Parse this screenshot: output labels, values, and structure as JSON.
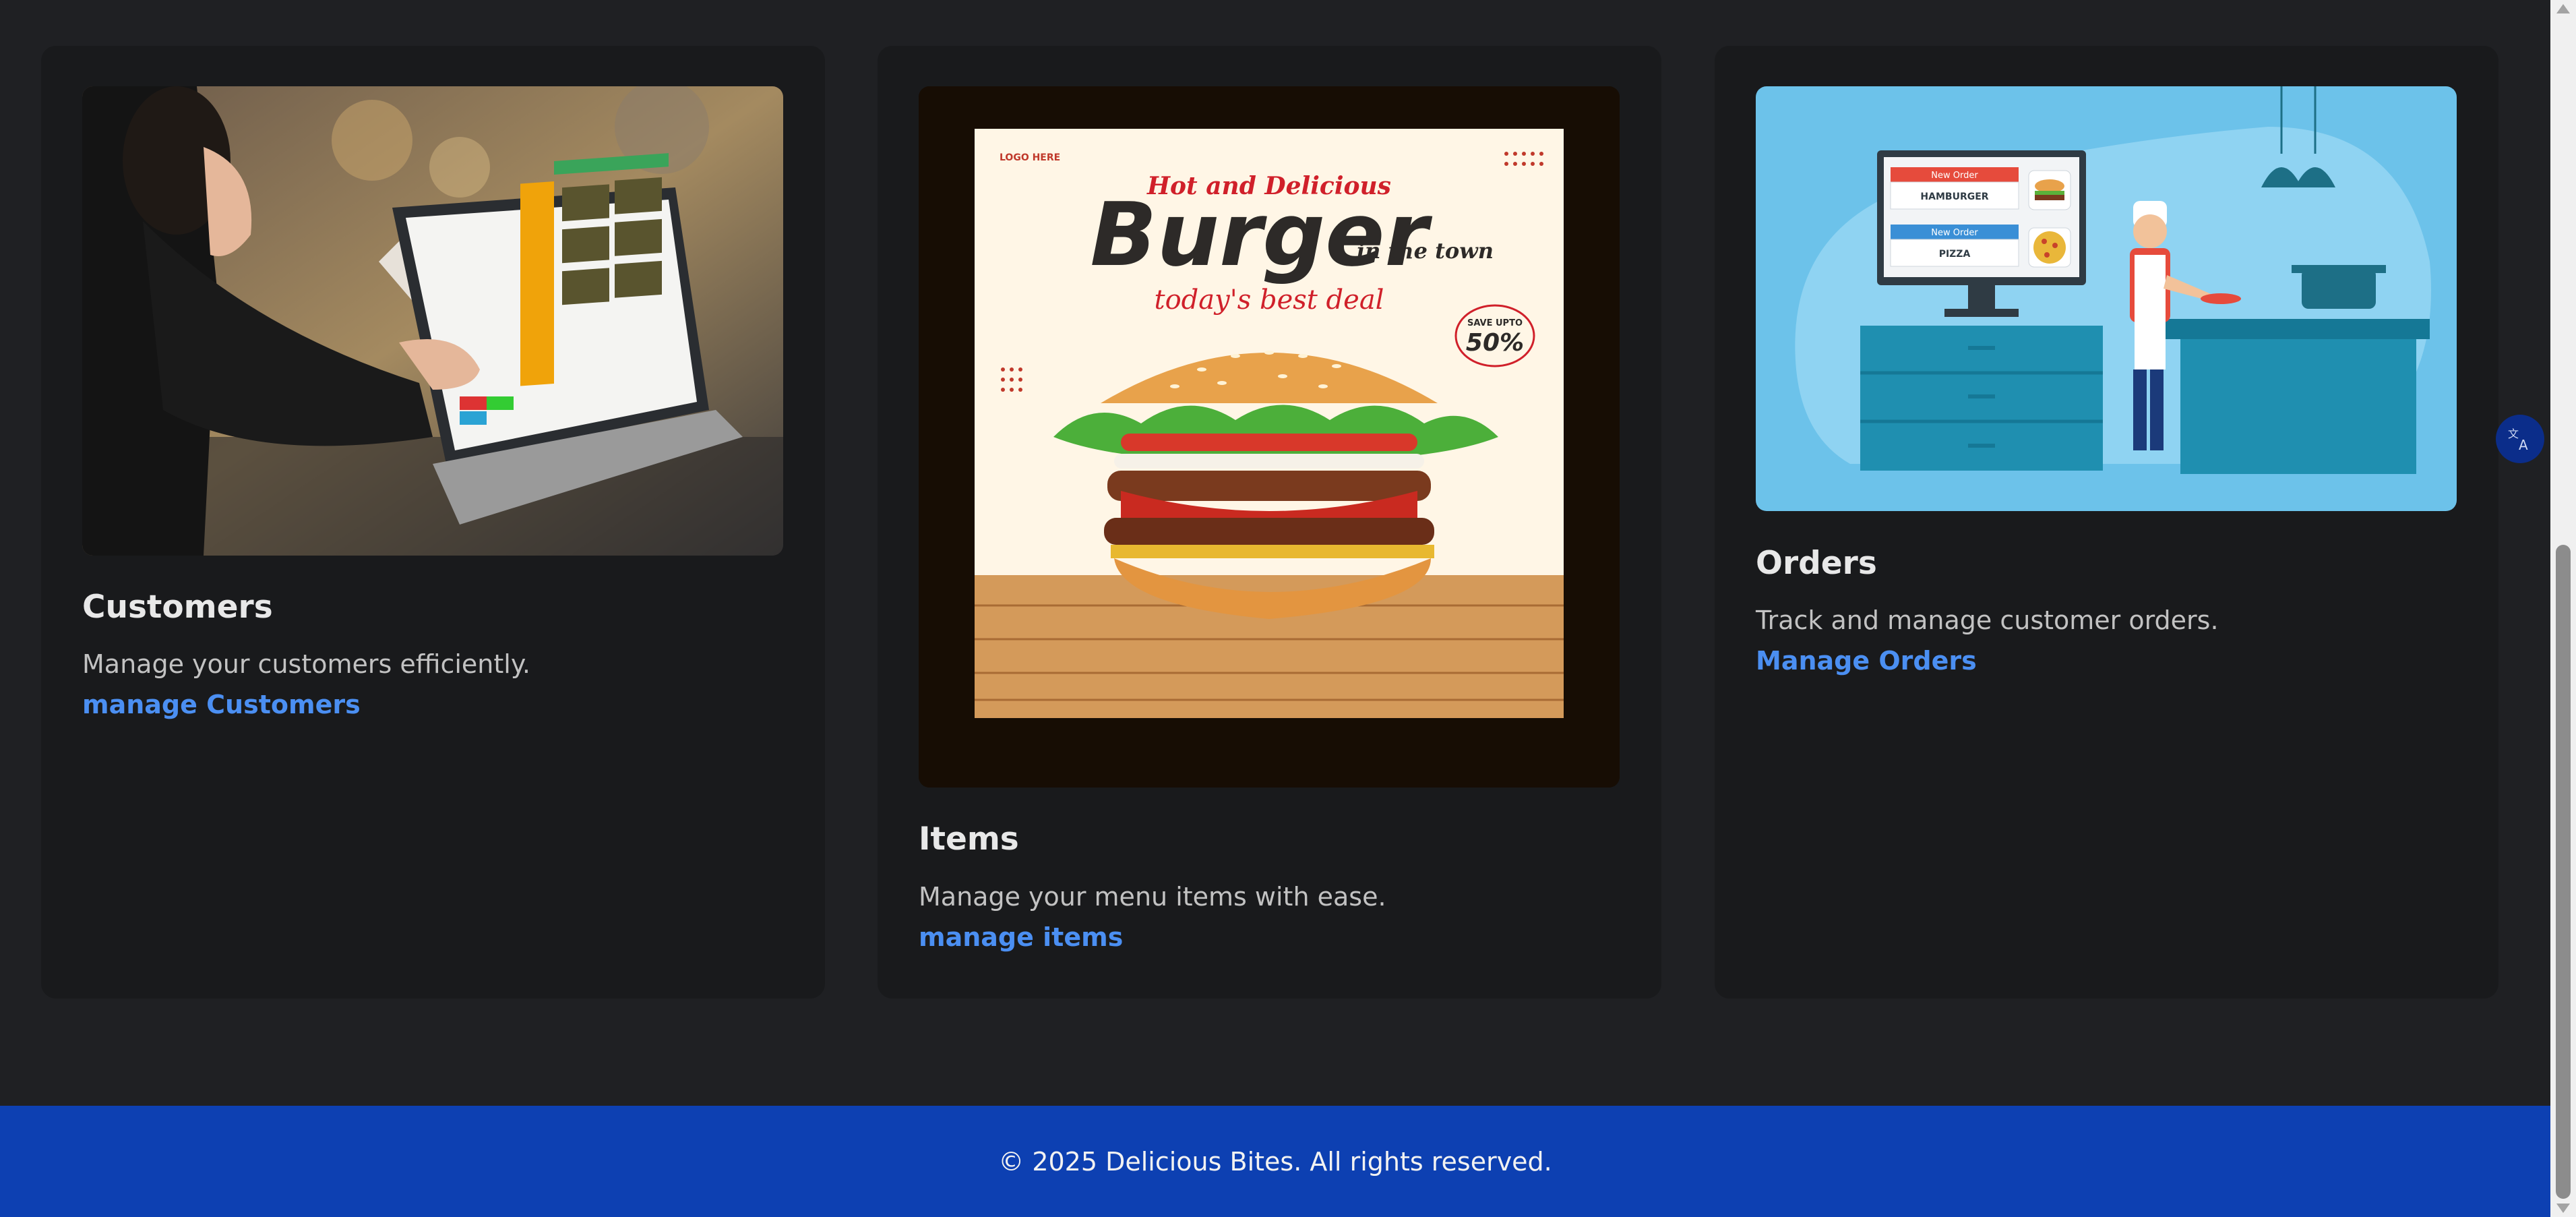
{
  "cards": [
    {
      "title": "Customers",
      "description": "Manage your customers efficiently.",
      "link": "manage Customers",
      "image_alt": "Cashier using a POS touchscreen"
    },
    {
      "title": "Items",
      "description": "Manage your menu items with ease.",
      "link": "manage items",
      "image_alt": "Burger promotional poster"
    },
    {
      "title": "Orders",
      "description": "Track and manage customer orders.",
      "link": "Manage Orders",
      "image_alt": "Chef with order display screen"
    }
  ],
  "burger_poster": {
    "logo": "LOGO HERE",
    "headline_top": "Hot and Delicious",
    "headline": "Burger",
    "headline_sub": "in the town",
    "tagline": "today's best deal",
    "badge_top": "SAVE UPTO",
    "badge_value": "50%"
  },
  "orders_screen": {
    "order1_header": "New Order",
    "order1_item": "HAMBURGER",
    "order2_header": "New Order",
    "order2_item": "PIZZA"
  },
  "footer": {
    "text": "© 2025 Delicious Bites. All rights reserved."
  },
  "colors": {
    "background": "#1f2023",
    "card": "#191a1c",
    "link": "#4b8ff2",
    "footer": "#0d40b2"
  }
}
